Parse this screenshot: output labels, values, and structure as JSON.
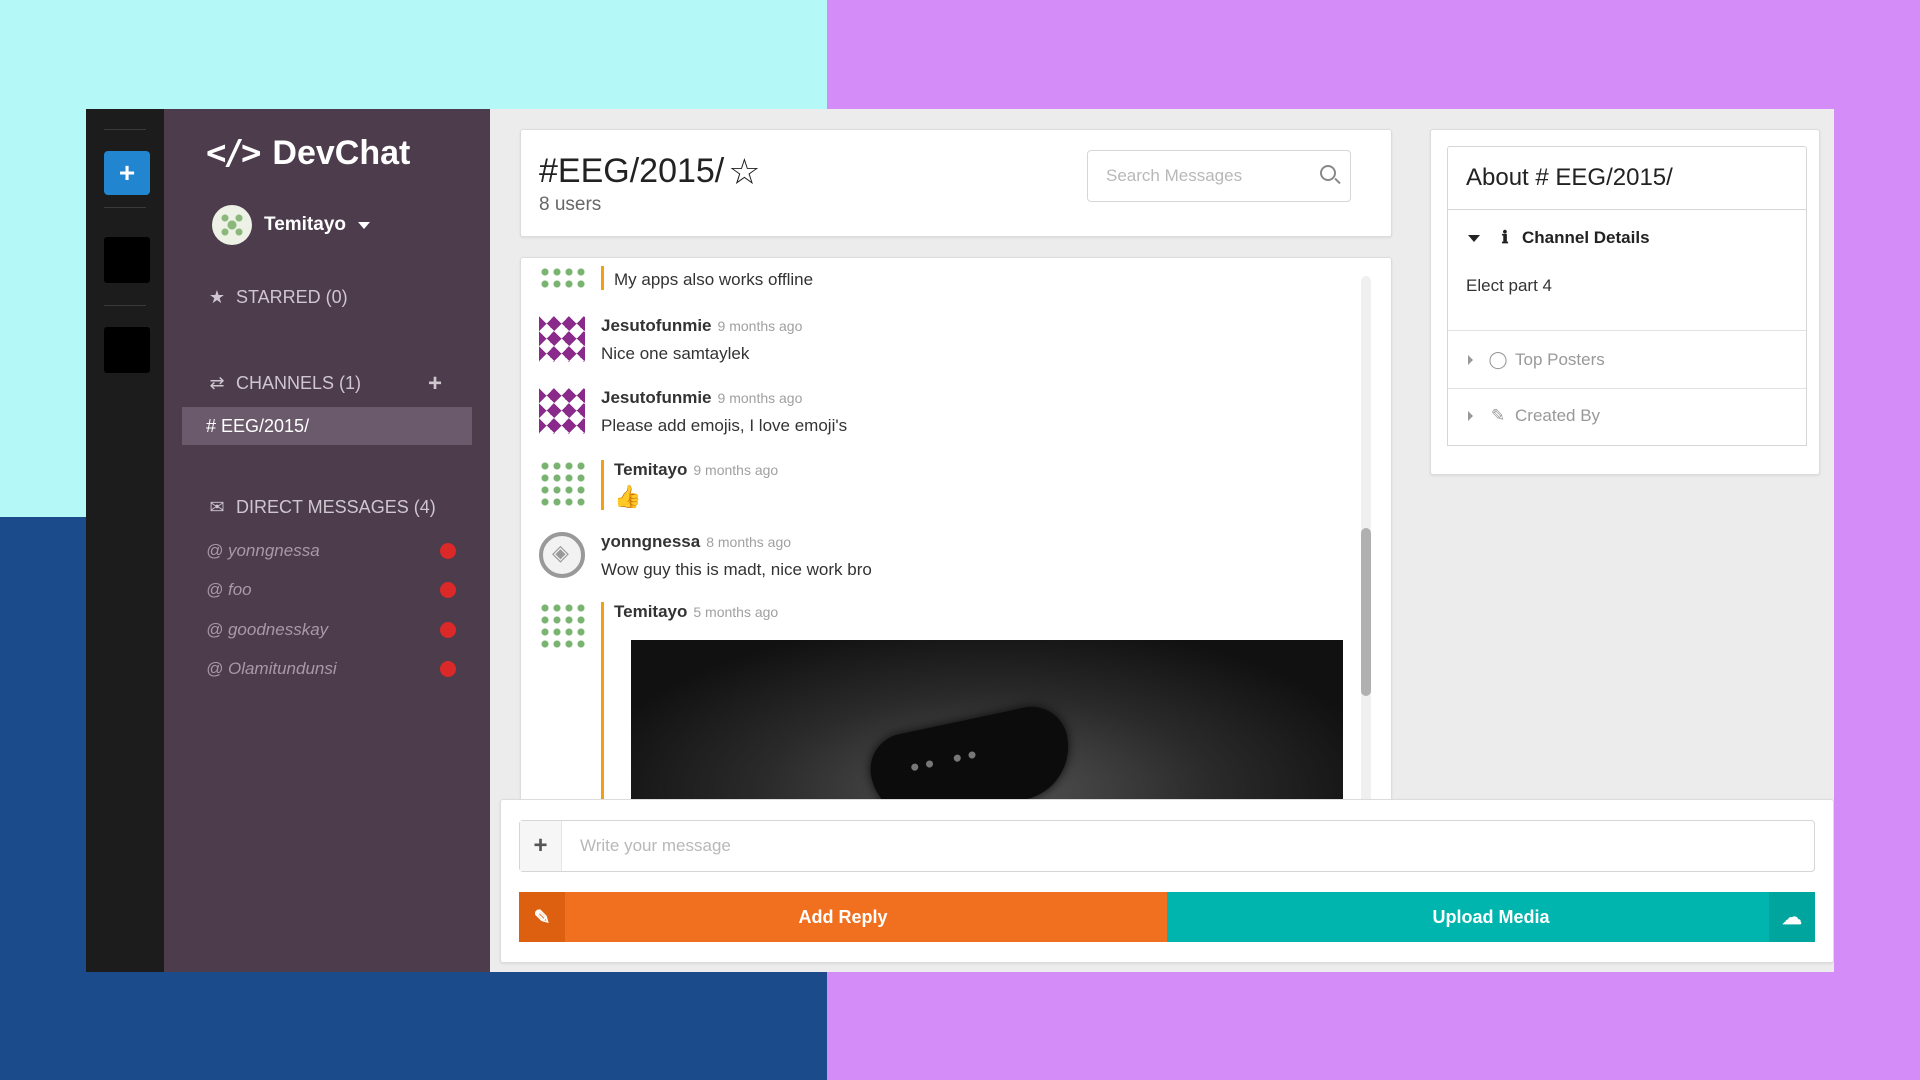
{
  "brand": {
    "name": "DevChat"
  },
  "user": {
    "name": "Temitayo"
  },
  "sidebar": {
    "starred_label": "STARRED (0)",
    "channels_label": "CHANNELS (1)",
    "active_channel": "# EEG/2015/",
    "dm_label": "DIRECT MESSAGES (4)",
    "dms": [
      "@ yonngnessa",
      "@ foo",
      "@ goodnesskay",
      "@ Olamitundunsi"
    ],
    "status_color": "#db2828"
  },
  "channel": {
    "title": "#EEG/2015/",
    "users": "8 users"
  },
  "search": {
    "placeholder": "Search Messages"
  },
  "messages": [
    {
      "text": "My apps also works offline"
    },
    {
      "author": "Jesutofunmie",
      "time": "9 months ago",
      "text": "Nice one samtaylek"
    },
    {
      "author": "Jesutofunmie",
      "time": "9 months ago",
      "text": "Please add emojis, I love emoji's"
    },
    {
      "author": "Temitayo",
      "time": "9 months ago",
      "text": "👍"
    },
    {
      "author": "yonngnessa",
      "time": "8 months ago",
      "text": "Wow guy this is madt, nice work bro"
    },
    {
      "author": "Temitayo",
      "time": "5 months ago"
    }
  ],
  "composer": {
    "placeholder": "Write your message",
    "add_reply": "Add Reply",
    "upload_media": "Upload Media"
  },
  "about": {
    "title": "About # EEG/2015/",
    "channel_details": "Channel Details",
    "details_text": "Elect part 4",
    "top_posters": "Top Posters",
    "created_by": "Created By"
  },
  "colors": {
    "accent_blue": "#2185d0",
    "reply_orange": "#f07020",
    "upload_teal": "#00b5ad",
    "sidebar_bg": "#4c3c4c"
  }
}
